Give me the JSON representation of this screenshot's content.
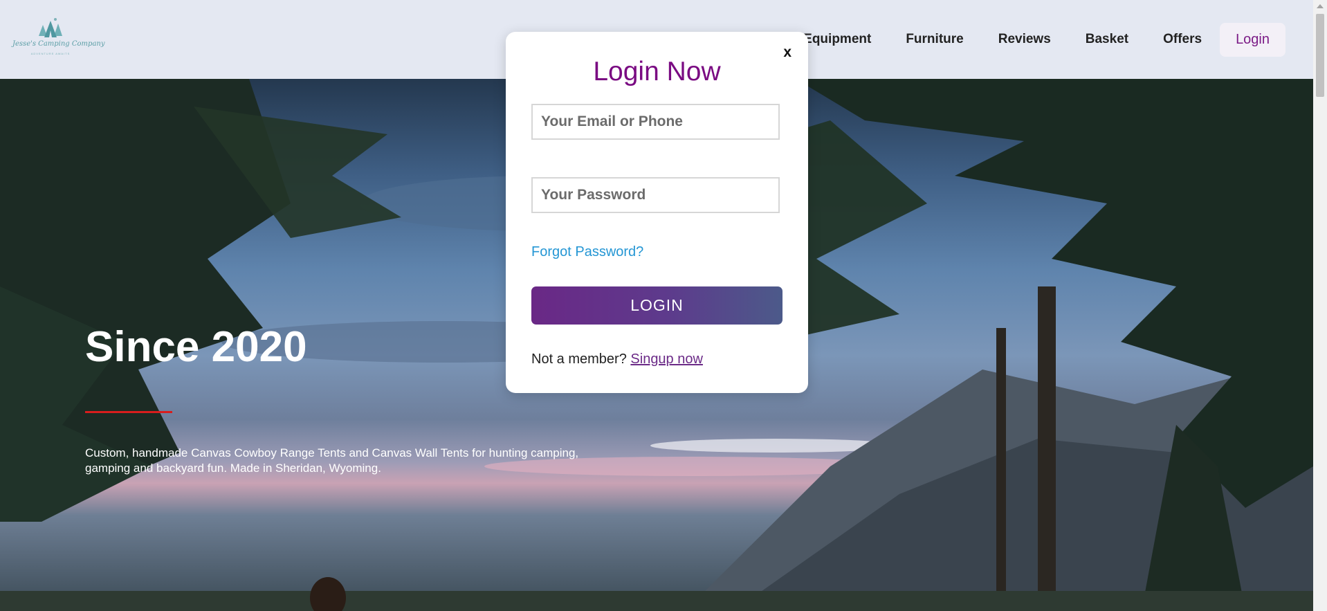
{
  "logo": {
    "name": "Jesse's Camping Company",
    "tagline": "ADVENTURE AWAITS"
  },
  "nav": {
    "items": [
      {
        "label": "Equipment"
      },
      {
        "label": "Furniture"
      },
      {
        "label": "Reviews"
      },
      {
        "label": "Basket"
      },
      {
        "label": "Offers"
      }
    ],
    "login_label": "Login"
  },
  "hero": {
    "title": "Since 2020",
    "description": "Custom, handmade Canvas Cowboy Range Tents and Canvas Wall Tents for hunting camping, gamping and backyard fun. Made in Sheridan, Wyoming."
  },
  "login_modal": {
    "close_label": "x",
    "title": "Login Now",
    "email_placeholder": "Your Email or Phone",
    "password_placeholder": "Your Password",
    "forgot_label": "Forgot Password?",
    "submit_label": "LOGIN",
    "signup_prompt": "Not a member?",
    "signup_link": "Singup now"
  },
  "colors": {
    "header_bg": "#e4e8f2",
    "accent_purple": "#7a0b82",
    "link_blue": "#2496d4",
    "hero_rule_red": "#d81d1d"
  }
}
